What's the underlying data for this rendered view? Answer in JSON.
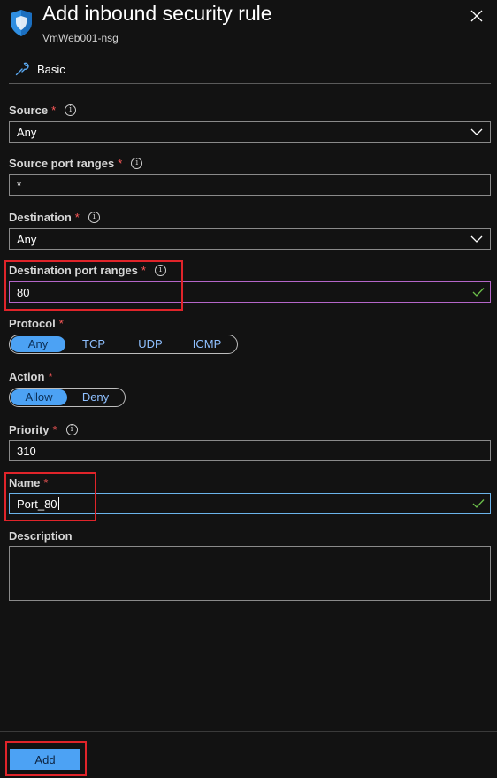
{
  "panel": {
    "title": "Add inbound security rule",
    "subtitle": "VmWeb001-nsg"
  },
  "tab": {
    "label": "Basic"
  },
  "form": {
    "source": {
      "label": "Source",
      "required": "*",
      "value": "Any"
    },
    "source_port_ranges": {
      "label": "Source port ranges",
      "required": "*",
      "value": "*"
    },
    "destination": {
      "label": "Destination",
      "required": "*",
      "value": "Any"
    },
    "destination_port_ranges": {
      "label": "Destination port ranges",
      "required": "*",
      "value": "80"
    },
    "protocol": {
      "label": "Protocol",
      "required": "*",
      "options": [
        "Any",
        "TCP",
        "UDP",
        "ICMP"
      ],
      "selected": "Any"
    },
    "action": {
      "label": "Action",
      "required": "*",
      "options": [
        "Allow",
        "Deny"
      ],
      "selected": "Allow"
    },
    "priority": {
      "label": "Priority",
      "required": "*",
      "value": "310"
    },
    "name": {
      "label": "Name",
      "required": "*",
      "value": "Port_80"
    },
    "description": {
      "label": "Description",
      "value": ""
    }
  },
  "footer": {
    "add_label": "Add"
  },
  "colors": {
    "background": "#121212",
    "accent": "#4ca2f4",
    "required": "#ff5a5a",
    "highlight": "#e0242a",
    "valid_check": "#6cc04a"
  },
  "icons": [
    "shield-icon",
    "close-icon",
    "wrench-icon",
    "info-icon",
    "chevron-down-icon",
    "checkmark-icon"
  ]
}
